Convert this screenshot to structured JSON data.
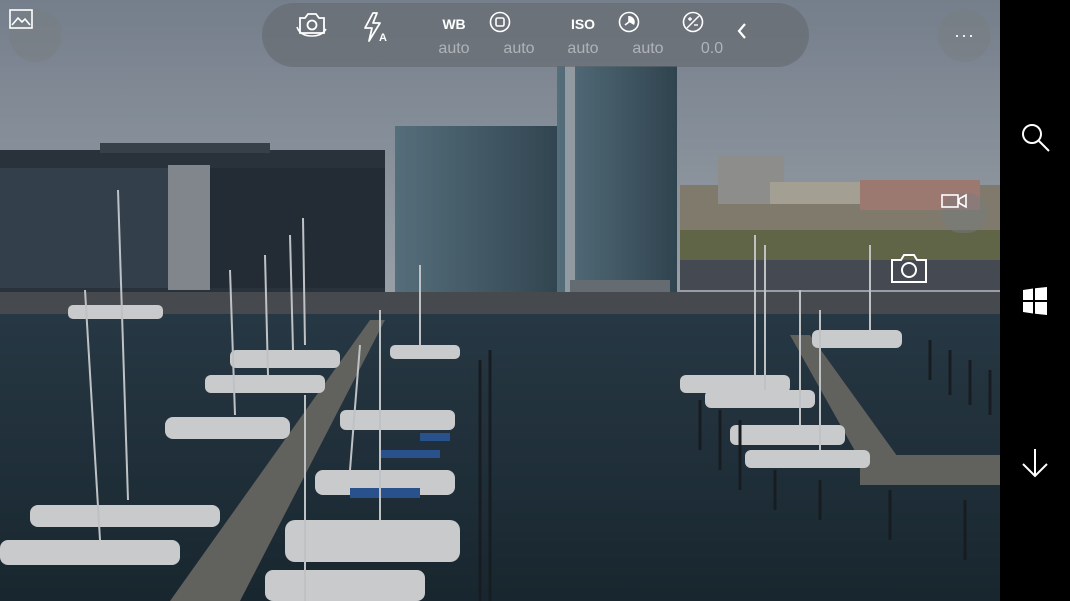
{
  "top_bar": {
    "items": [
      {
        "icon": "switch-camera-icon"
      },
      {
        "icon": "flash-auto-icon",
        "flash_badge": "A"
      },
      {
        "label": "WB",
        "value": "auto"
      },
      {
        "icon": "focus-icon",
        "value": "auto"
      },
      {
        "label": "ISO",
        "value": "auto"
      },
      {
        "icon": "shutter-speed-icon",
        "value": "auto"
      },
      {
        "icon": "exposure-compensation-icon",
        "value": "0.0"
      },
      {
        "icon": "chevron-left-icon"
      }
    ]
  },
  "left_button": {
    "icon": "gallery-icon"
  },
  "right_button": {
    "icon": "more-icon",
    "label": "···"
  },
  "capture": {
    "video_icon": "video-camera-icon",
    "photo_icon": "camera-icon"
  },
  "nav": {
    "items": [
      "search-icon",
      "windows-logo-icon",
      "arrow-down-icon"
    ]
  },
  "colors": {
    "overlay": "#64696e",
    "text": "#ffffff",
    "muted_text": "#e6e8eb",
    "nav_bg": "#000000"
  }
}
